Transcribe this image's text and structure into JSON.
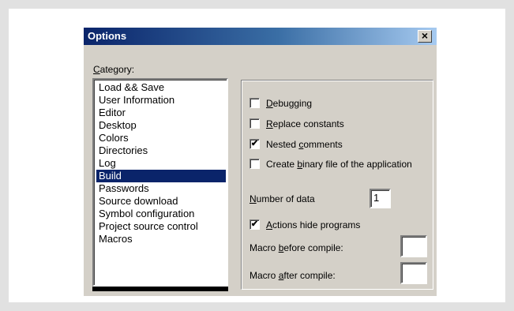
{
  "dialog": {
    "title": "Options",
    "close_glyph": "×",
    "category_label": "Category:",
    "categories": [
      "Load && Save",
      "User Information",
      "Editor",
      "Desktop",
      "Colors",
      "Directories",
      "Log",
      "Build",
      "Passwords",
      "Source download",
      "Symbol configuration",
      "Project source control",
      "Macros"
    ],
    "selected_category": "Build",
    "options": {
      "debugging": {
        "label": "Debugging",
        "checked": false
      },
      "replace_constants": {
        "label": "Replace constants",
        "checked": false
      },
      "nested_comments": {
        "label": "Nested comments",
        "checked": true
      },
      "create_binary": {
        "label": "Create binary file of the application",
        "checked": false
      },
      "actions_hide_programs": {
        "label": "Actions hide programs",
        "checked": true
      }
    },
    "number_of_data": {
      "label": "Number of data",
      "value": "1"
    },
    "macro_before_compile": {
      "label": "Macro before compile:",
      "value": ""
    },
    "macro_after_compile": {
      "label": "Macro after compile:",
      "value": ""
    }
  },
  "colors": {
    "selection": "#0a246a",
    "face": "#d4d0c8"
  }
}
